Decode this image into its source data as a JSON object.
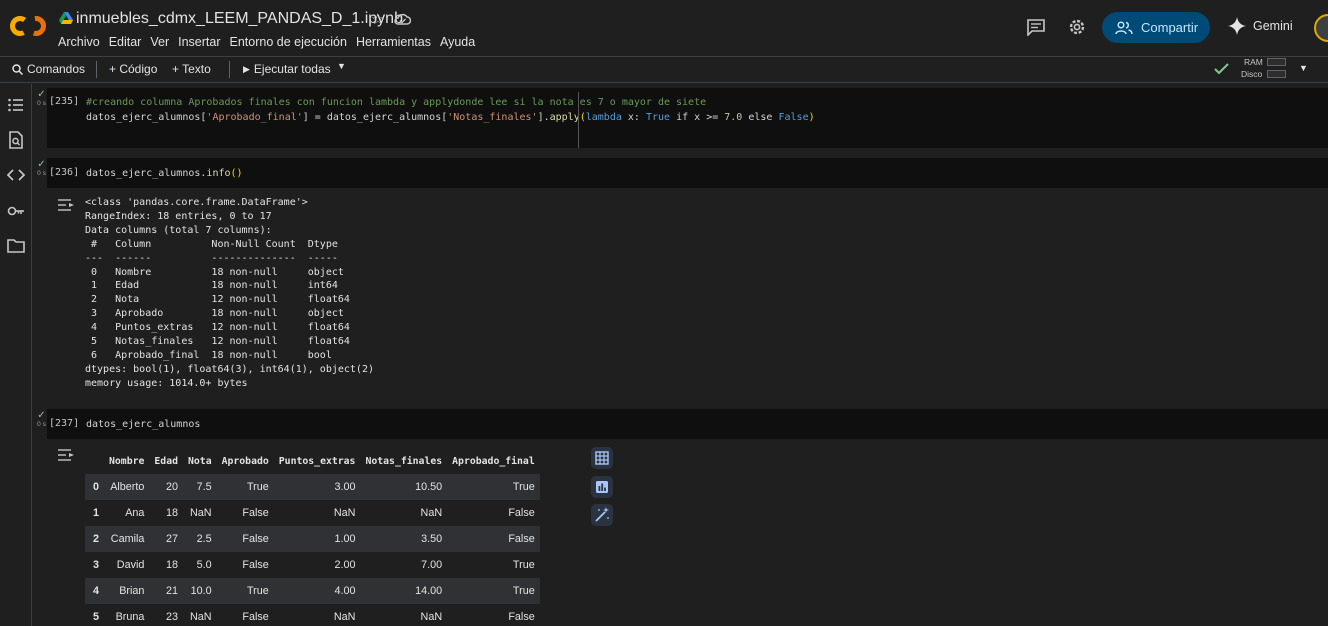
{
  "app": {
    "notebook_title": "inmuebles_cdmx_LEEM_PANDAS_D_1.ipynb",
    "menu": [
      "Archivo",
      "Editar",
      "Ver",
      "Insertar",
      "Entorno de ejecución",
      "Herramientas",
      "Ayuda"
    ],
    "share_label": "Compartir",
    "gemini_label": "Gemini"
  },
  "toolbar": {
    "commands_label": "Comandos",
    "add_code_label": "+ Código",
    "add_text_label": "+ Texto",
    "run_all_label": "Ejecutar todas",
    "ram_label": "RAM",
    "disk_label": "Disco"
  },
  "colors": {
    "accent": "#004a77",
    "check": "#81c995",
    "background": "#1f1f1f",
    "code_bg": "#0f0f0f"
  },
  "cells": [
    {
      "prompt": "[235]",
      "time": "0 s",
      "lines": [
        "#creando columna Aprobados finales con funcion lambda y applydonde lee si la nota es 7 o mayor de siete",
        "datos_ejerc_alumnos['Aprobado_final'] = datos_ejerc_alumnos['Notas_finales'].apply(lambda x: True if x >= 7.0 else False)"
      ]
    },
    {
      "prompt": "[236]",
      "time": "0 s",
      "lines": [
        "datos_ejerc_alumnos.info()"
      ],
      "output": [
        "<class 'pandas.core.frame.DataFrame'>",
        "RangeIndex: 18 entries, 0 to 17",
        "Data columns (total 7 columns):",
        " #   Column          Non-Null Count  Dtype  ",
        "---  ------          --------------  -----  ",
        " 0   Nombre          18 non-null     object ",
        " 1   Edad            18 non-null     int64  ",
        " 2   Nota            12 non-null     float64",
        " 3   Aprobado        18 non-null     object ",
        " 4   Puntos_extras   12 non-null     float64",
        " 5   Notas_finales   12 non-null     float64",
        " 6   Aprobado_final  18 non-null     bool   ",
        "dtypes: bool(1), float64(3), int64(1), object(2)",
        "memory usage: 1014.0+ bytes"
      ]
    },
    {
      "prompt": "[237]",
      "time": "0 s",
      "lines": [
        "datos_ejerc_alumnos"
      ]
    }
  ],
  "dataframe": {
    "columns": [
      "Nombre",
      "Edad",
      "Nota",
      "Aprobado",
      "Puntos_extras",
      "Notas_finales",
      "Aprobado_final"
    ],
    "rows": [
      [
        "0",
        "Alberto",
        "20",
        "7.5",
        "True",
        "3.00",
        "10.50",
        "True"
      ],
      [
        "1",
        "Ana",
        "18",
        "NaN",
        "False",
        "NaN",
        "NaN",
        "False"
      ],
      [
        "2",
        "Camila",
        "27",
        "2.5",
        "False",
        "1.00",
        "3.50",
        "False"
      ],
      [
        "3",
        "David",
        "18",
        "5.0",
        "False",
        "2.00",
        "7.00",
        "True"
      ],
      [
        "4",
        "Brian",
        "21",
        "10.0",
        "True",
        "4.00",
        "14.00",
        "True"
      ],
      [
        "5",
        "Bruna",
        "23",
        "NaN",
        "False",
        "NaN",
        "NaN",
        "False"
      ]
    ]
  }
}
